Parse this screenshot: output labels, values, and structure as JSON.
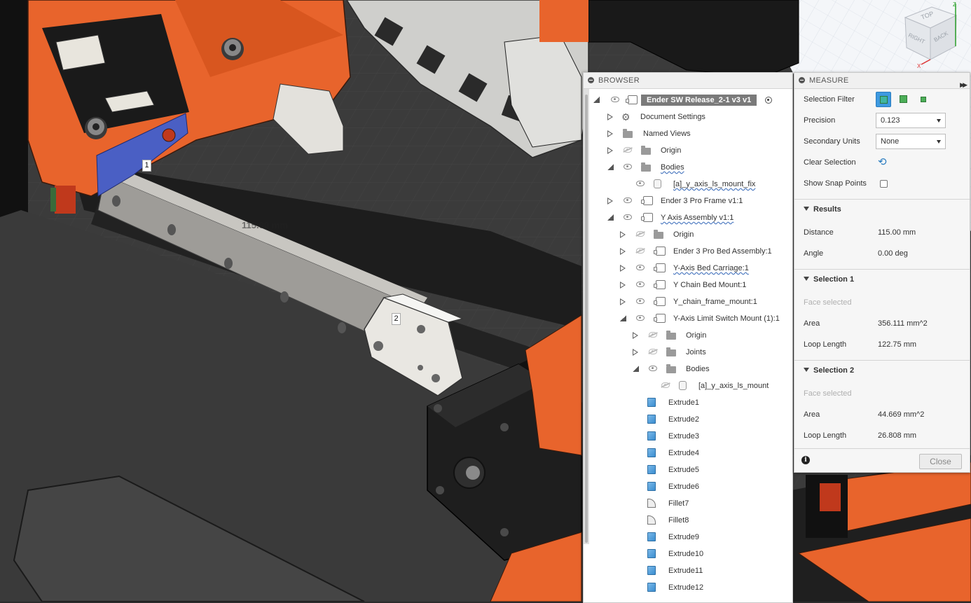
{
  "viewport": {
    "marker_1": "1",
    "marker_2": "2",
    "dimension_label": "115.00 mm",
    "viewcube": {
      "top": "TOP",
      "right": "RIGHT",
      "back": "BACK",
      "axis_z": "Z",
      "axis_x": "X"
    }
  },
  "browser": {
    "title": "BROWSER",
    "root": "Ender SW Release_2-1 v3 v1",
    "items": [
      {
        "label": "Document Settings"
      },
      {
        "label": "Named Views"
      },
      {
        "label": "Origin"
      },
      {
        "label": "Bodies"
      },
      {
        "label": "[a]_y_axis_ls_mount_fix"
      },
      {
        "label": "Ender 3 Pro Frame v1:1"
      },
      {
        "label": "Y Axis Assembly v1:1"
      },
      {
        "label": "Origin"
      },
      {
        "label": "Ender 3 Pro Bed Assembly:1"
      },
      {
        "label": "Y-Axis Bed Carriage:1"
      },
      {
        "label": "Y Chain Bed Mount:1"
      },
      {
        "label": "Y_chain_frame_mount:1"
      },
      {
        "label": "Y-Axis Limit Switch Mount (1):1"
      },
      {
        "label": "Origin"
      },
      {
        "label": "Joints"
      },
      {
        "label": "Bodies"
      },
      {
        "label": "[a]_y_axis_ls_mount"
      },
      {
        "label": "Extrude1"
      },
      {
        "label": "Extrude2"
      },
      {
        "label": "Extrude3"
      },
      {
        "label": "Extrude4"
      },
      {
        "label": "Extrude5"
      },
      {
        "label": "Extrude6"
      },
      {
        "label": "Fillet7"
      },
      {
        "label": "Fillet8"
      },
      {
        "label": "Extrude9"
      },
      {
        "label": "Extrude10"
      },
      {
        "label": "Extrude11"
      },
      {
        "label": "Extrude12"
      }
    ]
  },
  "measure": {
    "title": "MEASURE",
    "selection_filter_label": "Selection Filter",
    "precision_label": "Precision",
    "precision_value": "0.123",
    "secondary_units_label": "Secondary Units",
    "secondary_units_value": "None",
    "clear_selection_label": "Clear Selection",
    "show_snap_points_label": "Show Snap Points",
    "results": {
      "title": "Results",
      "distance_label": "Distance",
      "distance_value": "115.00 mm",
      "angle_label": "Angle",
      "angle_value": "0.00 deg"
    },
    "selection1": {
      "title": "Selection 1",
      "status": "Face selected",
      "area_label": "Area",
      "area_value": "356.111 mm^2",
      "loop_label": "Loop Length",
      "loop_value": "122.75 mm"
    },
    "selection2": {
      "title": "Selection 2",
      "status": "Face selected",
      "area_label": "Area",
      "area_value": "44.669 mm^2",
      "loop_label": "Loop Length",
      "loop_value": "26.808 mm"
    },
    "close_label": "Close"
  },
  "colors": {
    "orange": "#e8642c",
    "accent_blue": "#3e9ae0",
    "selected_face": "#4a5fc4"
  }
}
